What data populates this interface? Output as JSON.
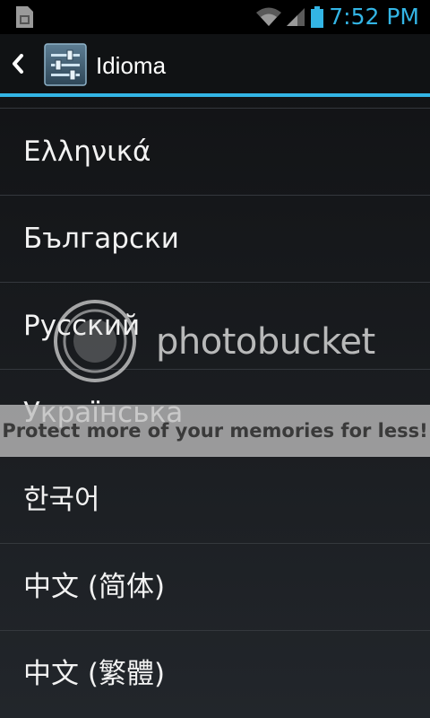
{
  "status_bar": {
    "time": "7:52 PM",
    "icons": [
      "sim-icon",
      "wifi-icon",
      "signal-icon",
      "battery-icon"
    ],
    "accent_color": "#33b5e5"
  },
  "action_bar": {
    "title": "Idioma",
    "icons": [
      "back-icon",
      "settings-app-icon"
    ]
  },
  "languages": [
    "Ελληνικά",
    "Български",
    "Русский",
    "Українська",
    "한국어",
    "中文 (简体)",
    "中文 (繁體)"
  ],
  "watermark": {
    "brand": "photobucket",
    "banner": "Protect more of your memories for less!"
  }
}
